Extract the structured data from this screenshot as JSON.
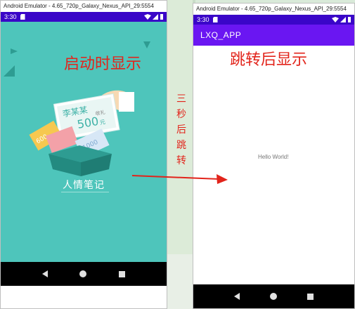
{
  "left_emulator": {
    "title": "Android Emulator - 4.65_720p_Galaxy_Nexus_API_29:5554",
    "status_time": "3:30",
    "splash_caption": "启动时显示",
    "app_name_label": "人情笔记",
    "card_name": "李某某",
    "card_amount": "500",
    "card_yuan": "元",
    "card_gift": "收礼",
    "card2_amount": "600",
    "card3_amount": "1000"
  },
  "right_emulator": {
    "title": "Android Emulator - 4.65_720p_Galaxy_Nexus_API_29:5554",
    "status_time": "3:30",
    "app_title": "LXQ_APP",
    "caption": "跳转后显示",
    "hello": "Hello World!"
  },
  "annotation": {
    "chars": [
      "三",
      "秒",
      "后",
      "跳",
      "转"
    ]
  },
  "colors": {
    "status_bar": "#3a06c8",
    "app_bar": "#6a16f2",
    "splash_bg": "#4ec5bb",
    "annotation_red": "#e2241b"
  },
  "icons": [
    "sd-card-icon",
    "wifi-icon",
    "signal-icon",
    "battery-icon",
    "back-icon",
    "home-icon",
    "recents-icon"
  ]
}
